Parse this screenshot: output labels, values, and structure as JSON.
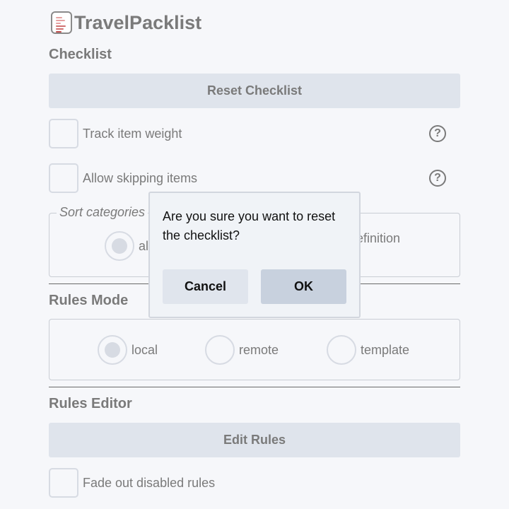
{
  "app": {
    "title": "TravelPacklist",
    "logo_icon": "checklist-document-icon"
  },
  "checklist": {
    "title": "Checklist",
    "reset_button": "Reset Checklist",
    "options": [
      {
        "label": "Track item weight",
        "checked": false,
        "help_icon": "?"
      },
      {
        "label": "Allow skipping items",
        "checked": false,
        "help_icon": "?"
      }
    ],
    "sort": {
      "legend": "Sort categories",
      "options": [
        {
          "label": "al",
          "selected": true
        },
        {
          "label": "efinition",
          "selected": false
        }
      ]
    }
  },
  "rules_mode": {
    "title": "Rules Mode",
    "options": [
      {
        "label": "local",
        "selected": true
      },
      {
        "label": "remote",
        "selected": false
      },
      {
        "label": "template",
        "selected": false
      }
    ]
  },
  "rules_editor": {
    "title": "Rules Editor",
    "edit_button": "Edit Rules",
    "fade_option": {
      "label": "Fade out disabled rules",
      "checked": false
    }
  },
  "dialog": {
    "message": "Are you sure you want to reset the checklist?",
    "cancel": "Cancel",
    "ok": "OK"
  },
  "colors": {
    "background": "#f6f7fa",
    "button_bg": "#dfe4ec",
    "text_muted": "#7a7a7a",
    "dialog_bg": "#f0f3f7",
    "ok_bg": "#c8d1de"
  }
}
